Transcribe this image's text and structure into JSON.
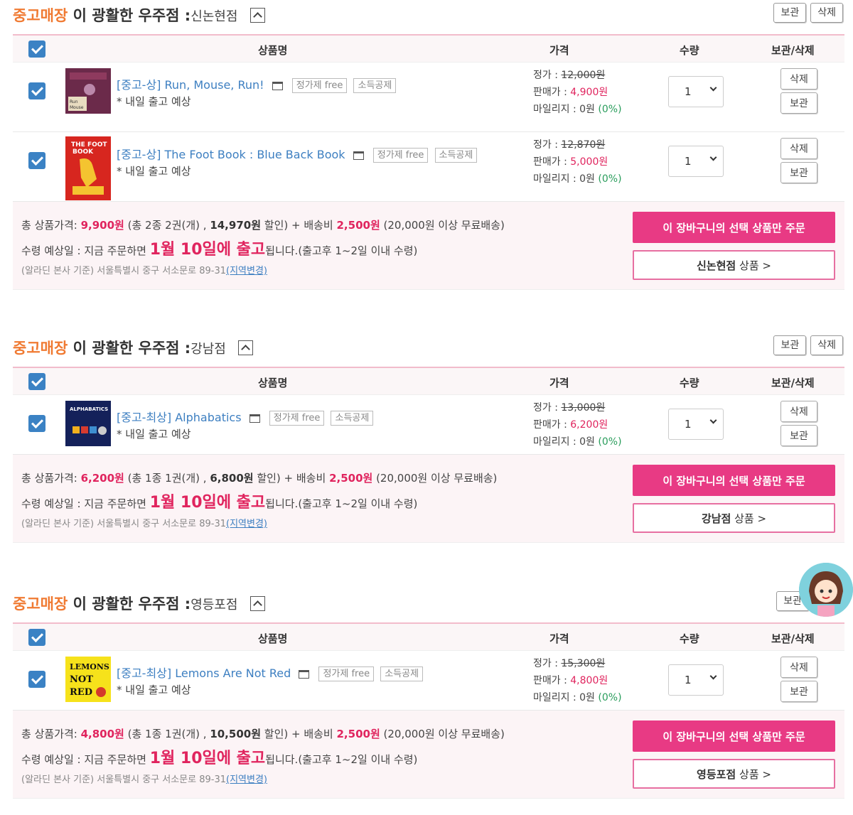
{
  "labels": {
    "used_store": "중고매장",
    "store_name": "이 광활한 우주점",
    "colon": ":",
    "keep": "보관",
    "delete": "삭제",
    "col_product": "상품명",
    "col_price": "가격",
    "col_qty": "수량",
    "col_action": "보관/삭제",
    "fixed_price_free": "정가제 free",
    "tax_deduct": "소득공제",
    "ship_msg": "* 내일 출고 예상",
    "list_price": "정가 : ",
    "sale_price": "판매가 : ",
    "mileage": "마일리지 : ",
    "order_selected": "이 장바구니의 선택 상품만 주문",
    "branch_goods": "상품 >",
    "total_label": "총 상품가격: ",
    "delivery_date_label": "수령 예상일 : 지금 주문하면 ",
    "delivery_big": "1월 10일에 출고",
    "delivery_tail": "됩니다.(출고후 1~2일 이내 수령)",
    "address": "(알라딘 본사 기준) 서울특별시 중구 서소문로 89-31",
    "address_change": "(지역변경)"
  },
  "shops": [
    {
      "branch": "신논현점",
      "items": [
        {
          "condition": "[중고-상]",
          "title": "Run, Mouse, Run!",
          "list_price": "12,000원",
          "sale_price": "4,900원",
          "mileage": "0원",
          "mileage_pct": "(0%)",
          "qty": "1"
        },
        {
          "condition": "[중고-상]",
          "title": "The Foot Book : Blue Back Book",
          "list_price": "12,870원",
          "sale_price": "5,000원",
          "mileage": "0원",
          "mileage_pct": "(0%)",
          "qty": "1"
        }
      ],
      "summary": {
        "price": "9,900원",
        "counts": "(총 2종 2권(개) , ",
        "discount": "14,970원",
        "discount_tail": " 할인) + 배송비 ",
        "shipping": "2,500원",
        "free_ship": " (20,000원 이상 무료배송)"
      }
    },
    {
      "branch": "강남점",
      "items": [
        {
          "condition": "[중고-최상]",
          "title": "Alphabatics",
          "list_price": "13,000원",
          "sale_price": "6,200원",
          "mileage": "0원",
          "mileage_pct": "(0%)",
          "qty": "1"
        }
      ],
      "summary": {
        "price": "6,200원",
        "counts": "(총 1종 1권(개) , ",
        "discount": "6,800원",
        "discount_tail": " 할인) + 배송비 ",
        "shipping": "2,500원",
        "free_ship": " (20,000원 이상 무료배송)"
      }
    },
    {
      "branch": "영등포점",
      "items": [
        {
          "condition": "[중고-최상]",
          "title": "Lemons Are Not Red",
          "list_price": "15,300원",
          "sale_price": "4,800원",
          "mileage": "0원",
          "mileage_pct": "(0%)",
          "qty": "1"
        }
      ],
      "summary": {
        "price": "4,800원",
        "counts": "(총 1종 1권(개) , ",
        "discount": "10,500원",
        "discount_tail": " 할인) + 배송비 ",
        "shipping": "2,500원",
        "free_ship": " (20,000원 이상 무료배송)"
      }
    }
  ],
  "book_covers": {
    "run_mouse_run": "RUN MOUSE RUN!",
    "foot_book": "THE FOOT BOOK",
    "alphabatics": "ALPHABATICS",
    "lemons": "LEMONS ARE NOT RED"
  },
  "colors": {
    "accent_pink": "#e83a84",
    "store_orange": "#f07a32",
    "link_blue": "#3d7fc1",
    "checkbox_blue": "#3b82c4"
  }
}
